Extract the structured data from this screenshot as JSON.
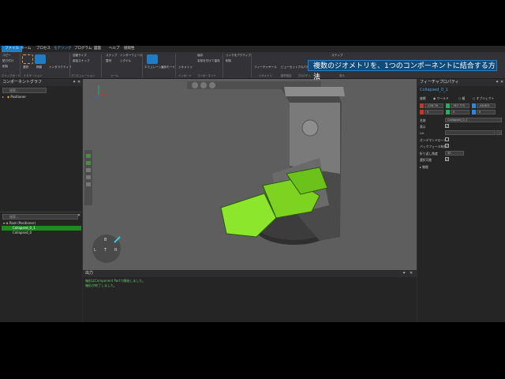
{
  "tabs": [
    "ファイル",
    "ホーム",
    "プロセス",
    "モデリング",
    "プログラム",
    "図面",
    "ヘルプ",
    "接続性"
  ],
  "ribbon": {
    "items": [
      "コピー",
      "貼り付け",
      "削除",
      "選択",
      "移動",
      "インタラクティブ",
      "自動サイズ",
      "部品スナップ",
      "スナップ",
      "整列",
      "インターフェース",
      "シグナル",
      "エミュレーション",
      "実行モード",
      "ジオメトリ",
      "保存",
      "名前を付けて保存",
      "リンクをアクティブ",
      "削除",
      "フィーチャー",
      "ツール",
      "ビューセット",
      "プロパティ",
      "ステップ"
    ],
    "groups": [
      "クリップボード",
      "ナビゲーション",
      "マニピュレーション",
      "ツール",
      "インポート",
      "コンポーネント",
      "ジオメトリ",
      "動作設定",
      "プロパティ",
      "接続",
      "表示"
    ]
  },
  "banner": "複数のジオメトリを、1つのコンポーネントに結合する方法",
  "left_panel": {
    "title": "コンポーネントグラフ",
    "search_placeholder": "検索...",
    "root_item": "Positioner"
  },
  "tree_panel": {
    "search_placeholder": "検索...",
    "items": [
      "Root (Positioner)",
      "Collapsed_0_1",
      "Collapsed_0"
    ]
  },
  "view_cube": {
    "top": "B",
    "left": "L",
    "center": "T",
    "right": "R"
  },
  "output": {
    "title": "出力",
    "lines": [
      "箱形はComponent Partで開始しました。",
      "箱形が終了しました。"
    ]
  },
  "properties": {
    "title": "フィーチャプロパティ",
    "feature_name": "Collapsed_0_1",
    "coord_label": "座標",
    "coord_options": [
      "ワールド",
      "親",
      "オブジェクト"
    ],
    "xyz": [
      {
        "axis": "X",
        "value": "-156.76",
        "color": "#c0392b"
      },
      {
        "axis": "Y",
        "value": "787.775",
        "color": "#27ae60"
      },
      {
        "axis": "Z",
        "value": "-46.601",
        "color": "#2e86de"
      }
    ],
    "rows": [
      {
        "label": "Rx",
        "value": "0"
      },
      {
        "label": "Ry",
        "value": "0"
      },
      {
        "label": "Rz",
        "value": "0"
      }
    ],
    "name_label": "名前",
    "name_value": "Collapsed_0_1",
    "fields": [
      "表示",
      "Uri",
      "オンデマンドロード",
      "バックフェース有効",
      "折り返し角度",
      "選択可能"
    ],
    "angle_value": "30",
    "section": "物理"
  }
}
